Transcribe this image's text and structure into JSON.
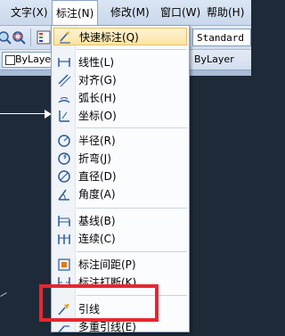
{
  "menubar": {
    "items": [
      {
        "label": "文字(X)"
      },
      {
        "label": "标注(N)"
      },
      {
        "label": "修改(M)"
      },
      {
        "label": "窗口(W)"
      },
      {
        "label": "帮助(H)"
      }
    ]
  },
  "toolbar": {
    "text_style": "Standard",
    "layer_left": "ByLayer",
    "layer_right": "ByLayer"
  },
  "dimension_menu": {
    "items": [
      {
        "label": "快速标注(Q)",
        "icon": "quick-dimension-icon"
      },
      {
        "label": "线性(L)",
        "icon": "linear-icon"
      },
      {
        "label": "对齐(G)",
        "icon": "aligned-icon"
      },
      {
        "label": "弧长(H)",
        "icon": "arc-length-icon"
      },
      {
        "label": "坐标(O)",
        "icon": "ordinate-icon"
      },
      {
        "label": "半径(R)",
        "icon": "radius-icon"
      },
      {
        "label": "折弯(J)",
        "icon": "jogged-icon"
      },
      {
        "label": "直径(D)",
        "icon": "diameter-icon"
      },
      {
        "label": "角度(A)",
        "icon": "angular-icon"
      },
      {
        "label": "基线(B)",
        "icon": "baseline-icon"
      },
      {
        "label": "连续(C)",
        "icon": "continue-icon"
      },
      {
        "label": "标注间距(P)",
        "icon": "dimension-space-icon"
      },
      {
        "label": "标注打断(K)",
        "icon": "dimension-break-icon"
      },
      {
        "label": "引线",
        "icon": "leader-icon"
      },
      {
        "label": "多重引线(E)",
        "icon": "multileader-icon"
      }
    ]
  },
  "colors": {
    "highlight_box": "#e8262e",
    "canvas_background": "#1f2a38"
  }
}
